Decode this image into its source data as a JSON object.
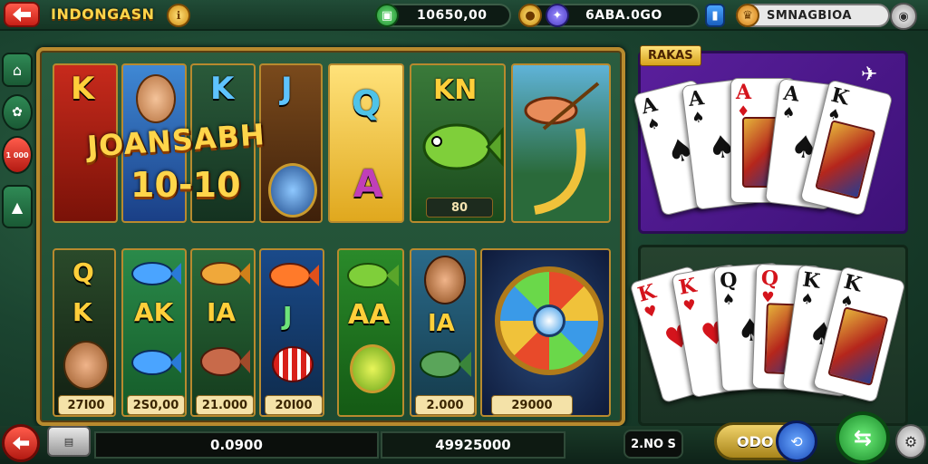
{
  "header": {
    "title": "INDONGASN",
    "balances": [
      "10650,00",
      "6ABA.0GO"
    ],
    "username": "SMNAGBIOA"
  },
  "board": {
    "logo_line1": "JOANSABH",
    "logo_line2": "10-10",
    "top_reels": [
      {
        "letter": "K"
      },
      {
        "letter": "K"
      },
      {
        "letter": "J"
      },
      {
        "letter": "Q",
        "letter2": "A"
      },
      {
        "letter": "KN",
        "value": "80"
      },
      {}
    ],
    "bottom_reels": [
      {
        "letter": "Q",
        "letter2": "K",
        "value": "27I00"
      },
      {
        "letter": "AK",
        "value": "2S0,00"
      },
      {
        "letter": "IA",
        "value": "21.000"
      },
      {
        "letter": "J",
        "value": "20I00"
      },
      {
        "letter": "AA",
        "value": ""
      },
      {
        "letter": "IA",
        "value": "2.000"
      },
      {
        "value": "29000"
      }
    ]
  },
  "side_panel": {
    "label": "RAKAS",
    "side_badge": "1 000"
  },
  "cards_top": [
    {
      "rank": "A",
      "suit": "♠",
      "color": "blk"
    },
    {
      "rank": "A",
      "suit": "♠",
      "color": "blk"
    },
    {
      "rank": "A",
      "suit": "♦",
      "color": "red"
    },
    {
      "rank": "A",
      "suit": "♠",
      "color": "blk"
    },
    {
      "rank": "K",
      "suit": "♠",
      "color": "blk"
    }
  ],
  "cards_bottom": [
    {
      "rank": "K",
      "suit": "♥",
      "color": "red"
    },
    {
      "rank": "K",
      "suit": "♥",
      "color": "red"
    },
    {
      "rank": "Q",
      "suit": "♠",
      "color": "blk"
    },
    {
      "rank": "Q",
      "suit": "♥",
      "color": "red"
    },
    {
      "rank": "K",
      "suit": "♠",
      "color": "blk"
    },
    {
      "rank": "K",
      "suit": "♠",
      "color": "blk"
    }
  ],
  "footer": {
    "bet": "0.0900",
    "win": "49925000",
    "lines": "2.NO S",
    "action": "ODO"
  },
  "colors": {
    "accent_gold": "#ffd54a",
    "back_red": "#e0281d",
    "panel_purple": "#4a168a",
    "button_green": "#2f8a55"
  }
}
